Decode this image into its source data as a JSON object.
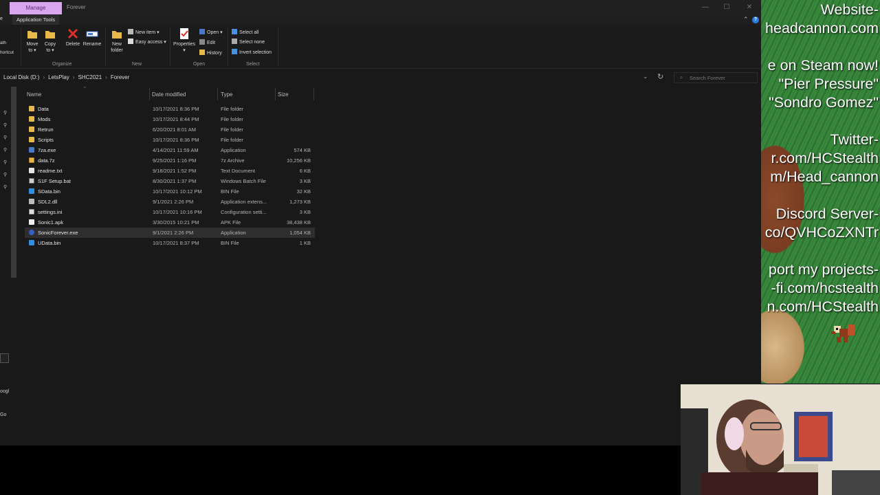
{
  "titlebar": {
    "manage_tab": "Manage",
    "title": "Forever",
    "buttons": {
      "minimize": "—",
      "maximize": "☐",
      "close": "✕"
    }
  },
  "ribbon_tabs": {
    "application_tools": "Application Tools",
    "cut_left": "e",
    "collapse": "⌃",
    "help": "?"
  },
  "ribbon": {
    "cut_left": [
      "ath",
      "hortcut"
    ],
    "organize": {
      "label": "Organize",
      "move_to": [
        "Move",
        "to ▾"
      ],
      "copy_to": [
        "Copy",
        "to ▾"
      ],
      "delete": "Delete",
      "rename": "Rename"
    },
    "new": {
      "label": "New",
      "new_folder": [
        "New",
        "folder"
      ],
      "new_item": "New item ▾",
      "easy_access": "Easy access ▾"
    },
    "open": {
      "label": "Open",
      "properties": [
        "Properties",
        "▾"
      ],
      "open": "Open ▾",
      "edit": "Edit",
      "history": "History"
    },
    "select": {
      "label": "Select",
      "select_all": "Select all",
      "select_none": "Select none",
      "invert_selection": "Invert selection"
    }
  },
  "address": {
    "breadcrumb": [
      "Local Disk (D:)",
      "LetsPlay",
      "SHC2021",
      "Forever"
    ],
    "dropdown": "⌄",
    "refresh": "↻",
    "search_placeholder": "Search Forever"
  },
  "nav_cut": [
    "oogl",
    "Go"
  ],
  "columns": {
    "name": "Name",
    "date": "Date modified",
    "type": "Type",
    "size": "Size"
  },
  "colors": {
    "folder": "#e8b84a",
    "exe": "#4a78c8",
    "bin": "#2f8fe0",
    "selected_row": "#2e2e2e",
    "manage_tab": "#d9a5ee"
  },
  "files": [
    {
      "name": "Data",
      "date": "10/17/2021 8:36 PM",
      "type": "File folder",
      "size": "",
      "icon": "folder-icon"
    },
    {
      "name": "Mods",
      "date": "10/17/2021 8:44 PM",
      "type": "File folder",
      "size": "",
      "icon": "folder-icon"
    },
    {
      "name": "Retrun",
      "date": "6/20/2021 8:01 AM",
      "type": "File folder",
      "size": "",
      "icon": "folder-icon"
    },
    {
      "name": "Scripts",
      "date": "10/17/2021 8:36 PM",
      "type": "File folder",
      "size": "",
      "icon": "folder-icon"
    },
    {
      "name": "7za.exe",
      "date": "4/14/2021 11:59 AM",
      "type": "Application",
      "size": "574 KB",
      "icon": "exe-icon"
    },
    {
      "name": "data.7z",
      "date": "9/25/2021 1:16 PM",
      "type": "7z Archive",
      "size": "10,256 KB",
      "icon": "archive-icon"
    },
    {
      "name": "readme.txt",
      "date": "9/18/2021 1:52 PM",
      "type": "Text Document",
      "size": "6 KB",
      "icon": "text-file-icon"
    },
    {
      "name": "S1F Setup.bat",
      "date": "8/30/2021 1:37 PM",
      "type": "Windows Batch File",
      "size": "3 KB",
      "icon": "batch-file-icon"
    },
    {
      "name": "SData.bin",
      "date": "10/17/2021 10:12 PM",
      "type": "BIN File",
      "size": "32 KB",
      "icon": "bin-file-icon"
    },
    {
      "name": "SDL2.dll",
      "date": "9/1/2021 2:26 PM",
      "type": "Application extens...",
      "size": "1,273 KB",
      "icon": "dll-icon"
    },
    {
      "name": "settings.ini",
      "date": "10/17/2021 10:16 PM",
      "type": "Configuration setti...",
      "size": "3 KB",
      "icon": "settings-file-icon"
    },
    {
      "name": "Sonic1.apk",
      "date": "3/30/2015 10:21 PM",
      "type": "APK File",
      "size": "38,438 KB",
      "icon": "generic-file-icon"
    },
    {
      "name": "SonicForever.exe",
      "date": "9/1/2021 2:26 PM",
      "type": "Application",
      "size": "1,054 KB",
      "icon": "sonic-app-icon",
      "selected": true
    },
    {
      "name": "UData.bin",
      "date": "10/17/2021 8:37 PM",
      "type": "BIN File",
      "size": "1 KB",
      "icon": "bin-file-icon"
    }
  ],
  "overlay": {
    "lines": [
      "Website-",
      "headcannon.com",
      "e on Steam now!",
      "\"Pier Pressure\"",
      "\"Sondro Gomez\"",
      "Twitter-",
      "r.com/HCStealth",
      "m/Head_cannon",
      "Discord Server-",
      "co/QVHCoZXNTr",
      "port my projects-",
      "-fi.com/hcstealth",
      "n.com/HCStealth"
    ]
  }
}
